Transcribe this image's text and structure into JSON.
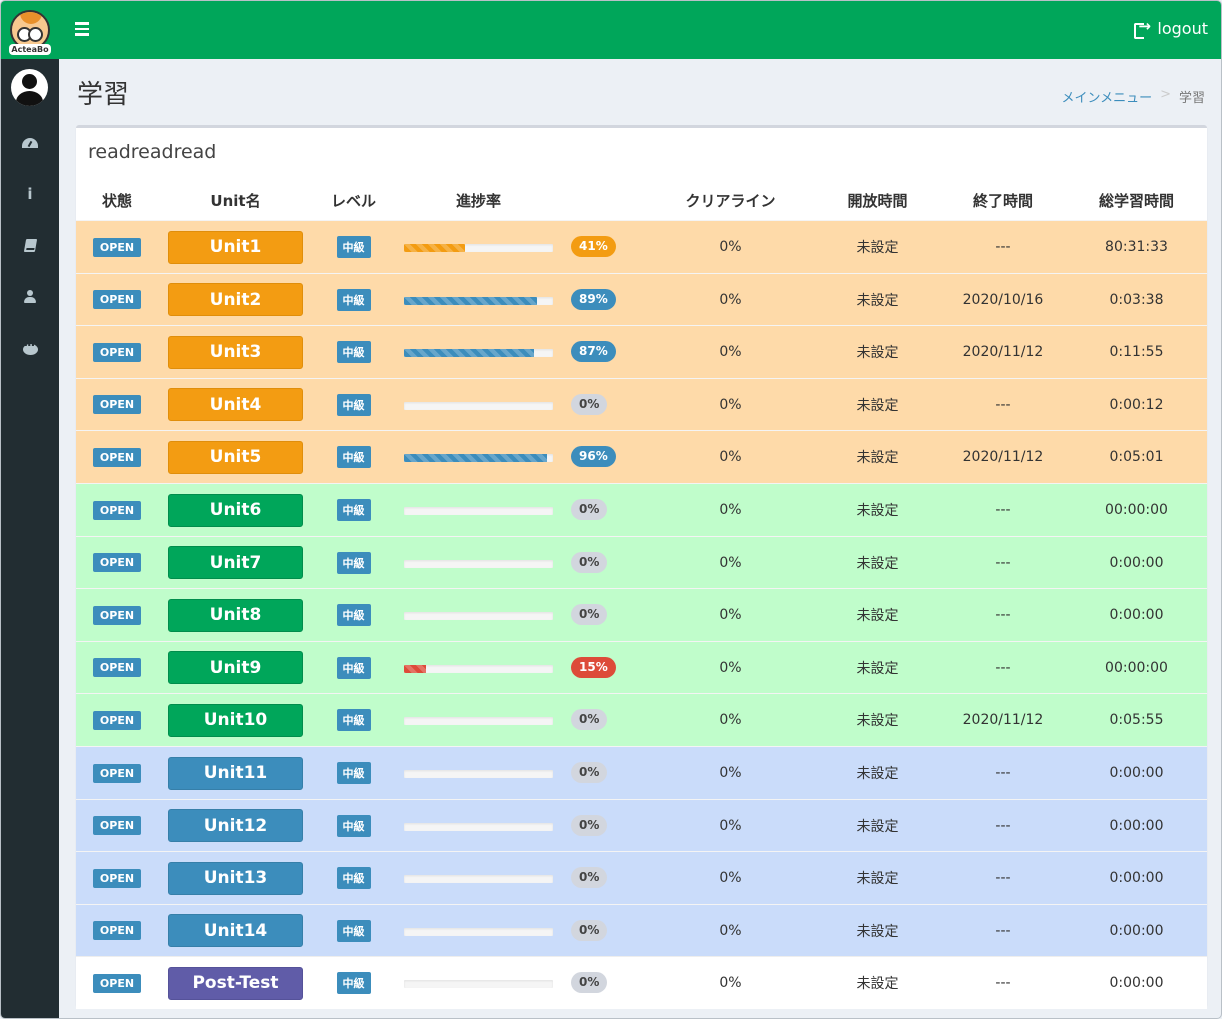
{
  "header": {
    "logo_text": "ActeaBo",
    "logout_label": "logout"
  },
  "page": {
    "title": "学習"
  },
  "breadcrumb": {
    "home": "メインメニュー",
    "sep": ">",
    "current": "学習"
  },
  "box": {
    "title": "readreadread"
  },
  "table": {
    "headers": {
      "status": "状態",
      "unit": "Unit名",
      "level": "レベル",
      "progress": "進捗率",
      "clearline": "クリアライン",
      "open_time": "開放時間",
      "end_time": "終了時間",
      "total_time": "総学習時間"
    },
    "rows": [
      {
        "status": "OPEN",
        "unit": "Unit1",
        "level": "中級",
        "progress": 41,
        "progress_label": "41%",
        "clearline": "0%",
        "open_time": "未設定",
        "end_time": "---",
        "total_time": "80:31:33",
        "group": "orange",
        "bar_color": "yellow",
        "pct_color": "yellow"
      },
      {
        "status": "OPEN",
        "unit": "Unit2",
        "level": "中級",
        "progress": 89,
        "progress_label": "89%",
        "clearline": "0%",
        "open_time": "未設定",
        "end_time": "2020/10/16",
        "total_time": "0:03:38",
        "group": "orange",
        "bar_color": "blue",
        "pct_color": "blue"
      },
      {
        "status": "OPEN",
        "unit": "Unit3",
        "level": "中級",
        "progress": 87,
        "progress_label": "87%",
        "clearline": "0%",
        "open_time": "未設定",
        "end_time": "2020/11/12",
        "total_time": "0:11:55",
        "group": "orange",
        "bar_color": "blue",
        "pct_color": "blue"
      },
      {
        "status": "OPEN",
        "unit": "Unit4",
        "level": "中級",
        "progress": 0,
        "progress_label": "0%",
        "clearline": "0%",
        "open_time": "未設定",
        "end_time": "---",
        "total_time": "0:00:12",
        "group": "orange",
        "bar_color": "blue",
        "pct_color": "gray"
      },
      {
        "status": "OPEN",
        "unit": "Unit5",
        "level": "中級",
        "progress": 96,
        "progress_label": "96%",
        "clearline": "0%",
        "open_time": "未設定",
        "end_time": "2020/11/12",
        "total_time": "0:05:01",
        "group": "orange",
        "bar_color": "blue",
        "pct_color": "blue"
      },
      {
        "status": "OPEN",
        "unit": "Unit6",
        "level": "中級",
        "progress": 0,
        "progress_label": "0%",
        "clearline": "0%",
        "open_time": "未設定",
        "end_time": "---",
        "total_time": "00:00:00",
        "group": "green",
        "bar_color": "blue",
        "pct_color": "gray"
      },
      {
        "status": "OPEN",
        "unit": "Unit7",
        "level": "中級",
        "progress": 0,
        "progress_label": "0%",
        "clearline": "0%",
        "open_time": "未設定",
        "end_time": "---",
        "total_time": "0:00:00",
        "group": "green",
        "bar_color": "blue",
        "pct_color": "gray"
      },
      {
        "status": "OPEN",
        "unit": "Unit8",
        "level": "中級",
        "progress": 0,
        "progress_label": "0%",
        "clearline": "0%",
        "open_time": "未設定",
        "end_time": "---",
        "total_time": "0:00:00",
        "group": "green",
        "bar_color": "blue",
        "pct_color": "gray"
      },
      {
        "status": "OPEN",
        "unit": "Unit9",
        "level": "中級",
        "progress": 15,
        "progress_label": "15%",
        "clearline": "0%",
        "open_time": "未設定",
        "end_time": "---",
        "total_time": "00:00:00",
        "group": "green",
        "bar_color": "red",
        "pct_color": "red"
      },
      {
        "status": "OPEN",
        "unit": "Unit10",
        "level": "中級",
        "progress": 0,
        "progress_label": "0%",
        "clearline": "0%",
        "open_time": "未設定",
        "end_time": "2020/11/12",
        "total_time": "0:05:55",
        "group": "green",
        "bar_color": "blue",
        "pct_color": "gray"
      },
      {
        "status": "OPEN",
        "unit": "Unit11",
        "level": "中級",
        "progress": 0,
        "progress_label": "0%",
        "clearline": "0%",
        "open_time": "未設定",
        "end_time": "---",
        "total_time": "0:00:00",
        "group": "blue",
        "bar_color": "blue",
        "pct_color": "gray"
      },
      {
        "status": "OPEN",
        "unit": "Unit12",
        "level": "中級",
        "progress": 0,
        "progress_label": "0%",
        "clearline": "0%",
        "open_time": "未設定",
        "end_time": "---",
        "total_time": "0:00:00",
        "group": "blue",
        "bar_color": "blue",
        "pct_color": "gray"
      },
      {
        "status": "OPEN",
        "unit": "Unit13",
        "level": "中級",
        "progress": 0,
        "progress_label": "0%",
        "clearline": "0%",
        "open_time": "未設定",
        "end_time": "---",
        "total_time": "0:00:00",
        "group": "blue",
        "bar_color": "blue",
        "pct_color": "gray"
      },
      {
        "status": "OPEN",
        "unit": "Unit14",
        "level": "中級",
        "progress": 0,
        "progress_label": "0%",
        "clearline": "0%",
        "open_time": "未設定",
        "end_time": "---",
        "total_time": "0:00:00",
        "group": "blue",
        "bar_color": "blue",
        "pct_color": "gray"
      },
      {
        "status": "OPEN",
        "unit": "Post-Test",
        "level": "中級",
        "progress": 0,
        "progress_label": "0%",
        "clearline": "0%",
        "open_time": "未設定",
        "end_time": "---",
        "total_time": "0:00:00",
        "group": "white",
        "bar_color": "blue",
        "pct_color": "gray"
      }
    ]
  },
  "colors": {
    "header": "#00a65a",
    "sidebar": "#222d32",
    "orange_row": "#fedaa9",
    "green_row": "#c0fdcb",
    "blue_row": "#cadcfa",
    "purple_button": "#605ca8"
  }
}
